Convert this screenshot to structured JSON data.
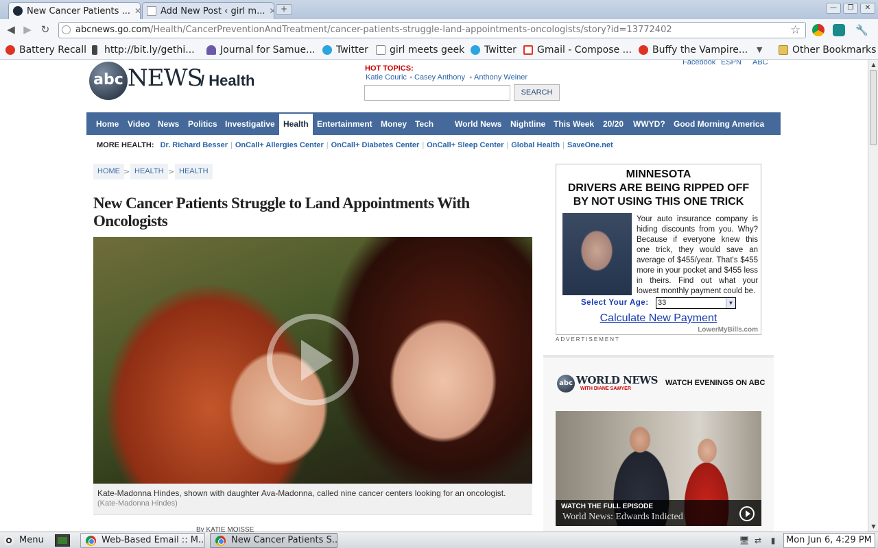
{
  "browser": {
    "tabs": [
      {
        "title": "New Cancer Patients ...",
        "active": true
      },
      {
        "title": "Add New Post ‹ girl m...",
        "active": false
      }
    ],
    "new_tab_symbol": "+",
    "address_host": "abcnews.go.com",
    "address_path": "/Health/CancerPreventionAndTreatment/cancer-patients-struggle-land-appointments-oncologists/story?id=13772402",
    "bookmarks": [
      {
        "label": "Battery Recall",
        "icon": "red-t-icon"
      },
      {
        "label": "http://bit.ly/gethi...",
        "icon": "microphone-icon"
      },
      {
        "label": "Journal for Samue...",
        "icon": "person-icon"
      },
      {
        "label": "Twitter",
        "icon": "twitter-bird-icon"
      },
      {
        "label": "girl meets geek",
        "icon": "page-icon"
      },
      {
        "label": "Twitter",
        "icon": "twitter-bird-icon"
      },
      {
        "label": "Gmail - Compose ...",
        "icon": "gmail-icon"
      },
      {
        "label": "Buffy the Vampire...",
        "icon": "red-t-icon"
      }
    ],
    "bookmarks_overflow": "▼",
    "other_bookmarks": "Other Bookmarks"
  },
  "page": {
    "logo_text": "abc",
    "logo_news": "NEWS",
    "logo_section": "/ Health",
    "top_links": [
      "Facebook",
      "ESPN",
      "ABC"
    ],
    "hot_topics_label": "HOT TOPICS:",
    "hot_topics": [
      "Katie Couric",
      "Casey Anthony",
      "Anthony Weiner"
    ],
    "search_button": "SEARCH",
    "nav_left": [
      "Home",
      "Video",
      "News",
      "Politics",
      "Investigative",
      "Health",
      "Entertainment",
      "Money",
      "Tech"
    ],
    "nav_right": [
      "World News",
      "Nightline",
      "This Week",
      "20/20",
      "WWYD?",
      "Good Morning America"
    ],
    "nav_active": "Health",
    "more_health_label": "MORE HEALTH:",
    "more_health_links": [
      "Dr. Richard Besser",
      "OnCall+ Allergies Center",
      "OnCall+ Diabetes Center",
      "OnCall+ Sleep Center",
      "Global Health",
      "SaveOne.net"
    ],
    "breadcrumbs": [
      "HOME",
      "HEALTH",
      "HEALTH"
    ],
    "headline": "New Cancer Patients Struggle to Land Appointments With Oncologists",
    "caption": "Kate-Madonna Hindes, shown with daughter Ava-Madonna, called nine cancer centers looking for an oncologist.",
    "caption_credit": "(Kate-Madonna Hindes)",
    "byline": "By KATIE MOISSE"
  },
  "ad": {
    "line1": "MINNESOTA",
    "line2": "DRIVERS ARE BEING RIPPED OFF",
    "line3": "BY NOT USING THIS ONE TRICK",
    "body": "Your auto insurance company is hiding discounts from you. Why? Because if everyone knew this one trick, they would save an average of $455/year. That's $455 more in your pocket and $455 less in theirs. Find out what your lowest monthly payment could be.",
    "age_label": "Select Your Age:",
    "age_value": "33",
    "cta": "Calculate New Payment",
    "brand": "LowerMyBills.com",
    "label": "ADVERTISEMENT"
  },
  "world_news": {
    "logo_abc": "abc",
    "logo_title": "WORLD NEWS",
    "logo_sub": "WITH DIANE SAWYER",
    "watch_label": "WATCH EVENINGS ON ABC",
    "video_top": "WATCH THE FULL EPISODE",
    "video_title": "World News: Edwards Indicted"
  },
  "taskbar": {
    "menu_label": "Menu",
    "tasks": [
      {
        "label": "Web-Based Email :: M...",
        "active": false
      },
      {
        "label": "New Cancer Patients S...",
        "active": true
      }
    ],
    "clock": "Mon Jun  6,  4:29 PM"
  },
  "colors": {
    "nav_bg": "#44699a",
    "link": "#2a64a8",
    "hot_topics": "#cc0000",
    "ad_blue": "#1a3db0"
  }
}
